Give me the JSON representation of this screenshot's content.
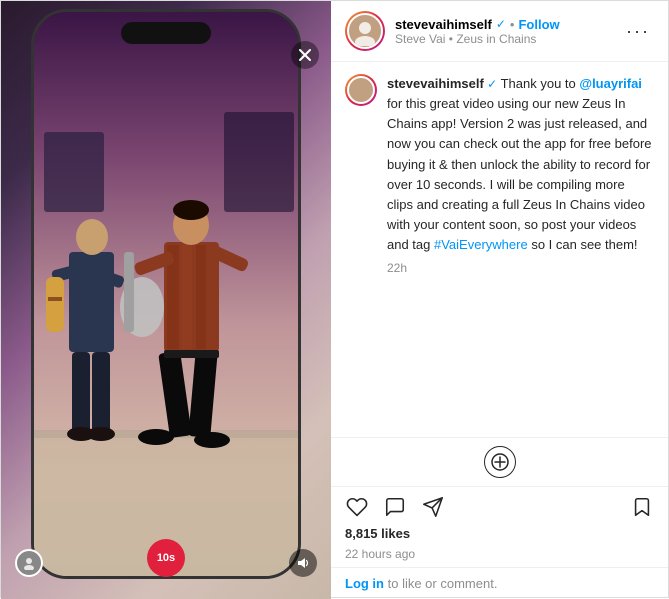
{
  "header": {
    "username": "stevevaihimself",
    "verified": true,
    "subtitle": "Steve Vai • Zeus in Chains",
    "follow_label": "Follow",
    "more_label": "···"
  },
  "caption": {
    "username": "stevevaihimself",
    "verified": true,
    "text1": " Thank you to ",
    "mention": "@luayrifai",
    "text2": " for this great video using our new Zeus In Chains app! Version 2 was just released, and now you can check out the app for free before buying it & then unlock the ability to record for over 10 seconds. I will be compiling more clips and creating a full Zeus In Chains video with your content soon, so post your videos and tag ",
    "hashtag": "#VaiEverywhere",
    "text3": " so I can see them!",
    "timestamp": "22h"
  },
  "timer": "10s",
  "likes": {
    "count": "8,815 likes",
    "time_ago": "22 hours ago"
  },
  "login_row": {
    "text": "Log in",
    "text2": " to like or comment."
  },
  "icons": {
    "heart": "heart-icon",
    "comment": "comment-icon",
    "share": "share-icon",
    "bookmark": "bookmark-icon",
    "close": "✕",
    "sound": "🔊",
    "add": "add-comment-icon"
  }
}
